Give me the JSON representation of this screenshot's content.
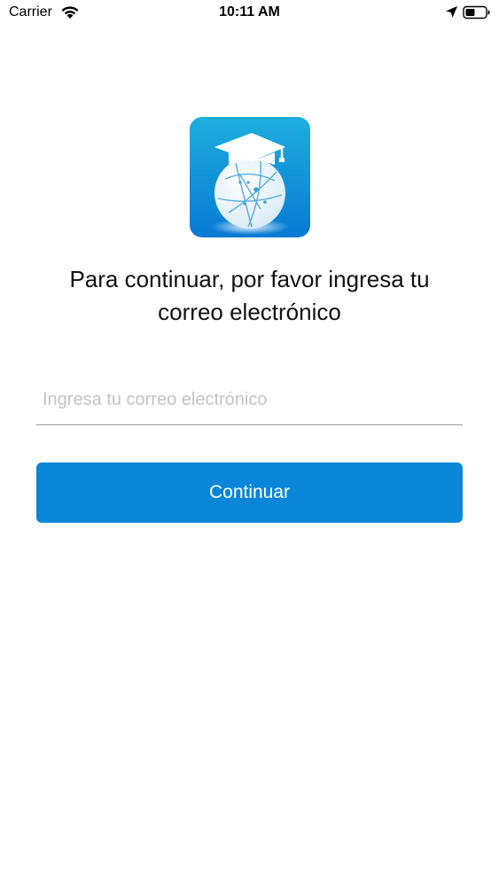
{
  "status_bar": {
    "carrier": "Carrier",
    "time": "10:11 AM",
    "wifi_icon": "wifi-icon",
    "location_icon": "location-arrow-icon",
    "battery_icon": "battery-icon"
  },
  "logo": {
    "icon": "graduation-cap-globe-icon",
    "colors": {
      "background_top": "#19a9dd",
      "background_bottom": "#0b7fd6",
      "cap": "#ffffff",
      "globe": "#f2f7fb",
      "globe_lines": "#3d9fd8"
    }
  },
  "instruction": {
    "text": "Para continuar, por favor ingresa tu correo electrónico"
  },
  "email": {
    "placeholder": "Ingresa tu correo electrónico",
    "value": ""
  },
  "continue_button": {
    "label": "Continuar",
    "color": "#0a86d8"
  }
}
